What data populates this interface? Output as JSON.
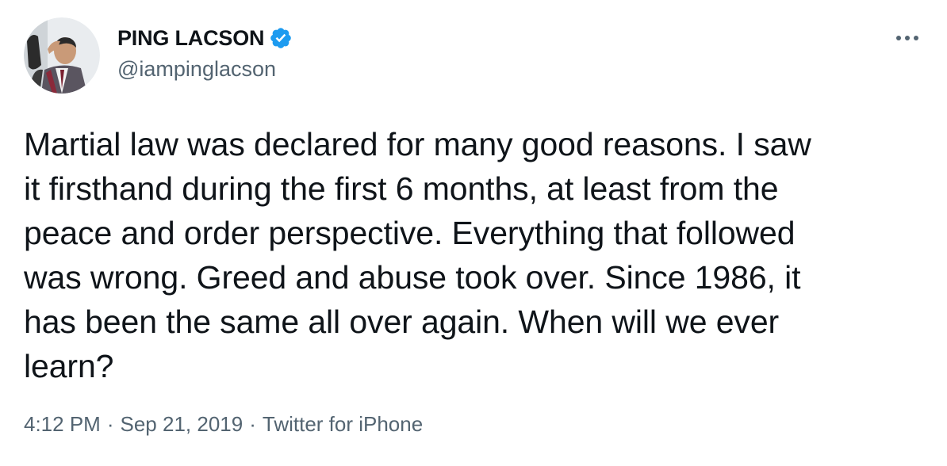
{
  "author": {
    "display_name": "PING LACSON",
    "handle": "@iampinglacson",
    "avatar_icon": "profile-photo",
    "verified_icon": "verified-badge-icon",
    "verified_color": "#1d9bf0"
  },
  "more_icon": "more-dots-icon",
  "tweet": {
    "lines": [
      "Martial law was declared for many good reasons. I saw",
      "it firsthand during the first 6 months, at least from the",
      "peace and order perspective. Everything that followed",
      "was wrong. Greed and abuse took over. Since 1986, it",
      "has been the same all over again. When will we ever",
      "learn?"
    ]
  },
  "meta": {
    "time": "4:12 PM",
    "separator": "·",
    "date": "Sep 21, 2019",
    "source": "Twitter for iPhone"
  },
  "colors": {
    "text": "#0f1419",
    "secondary": "#536471",
    "accent": "#1d9bf0"
  }
}
